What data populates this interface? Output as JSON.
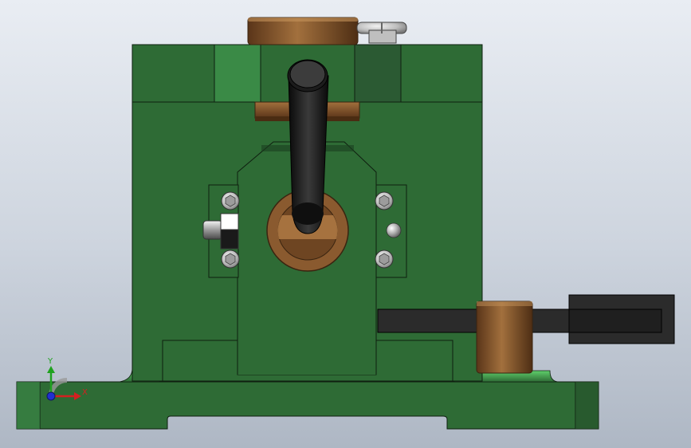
{
  "viewport": {
    "background_top": "#e9edf3",
    "background_bottom": "#aeb7c4"
  },
  "model": {
    "body_color": "#2e6b35",
    "edge_color": "#0f1f10",
    "highlight_panel_color": "#3a8a46",
    "shadow_panel_color": "#2b5a33",
    "bronze_color": "#8a5a2f",
    "bronze_dark": "#5e3a1a",
    "handle_color": "#1b1b1b",
    "arm_color": "#2b2b2b",
    "screw_color": "#c9c9c9"
  },
  "triad": {
    "x_label": "X",
    "y_label": "Y",
    "x_color": "#d42020",
    "y_color": "#1fa21f",
    "z_color": "#2030d0"
  }
}
